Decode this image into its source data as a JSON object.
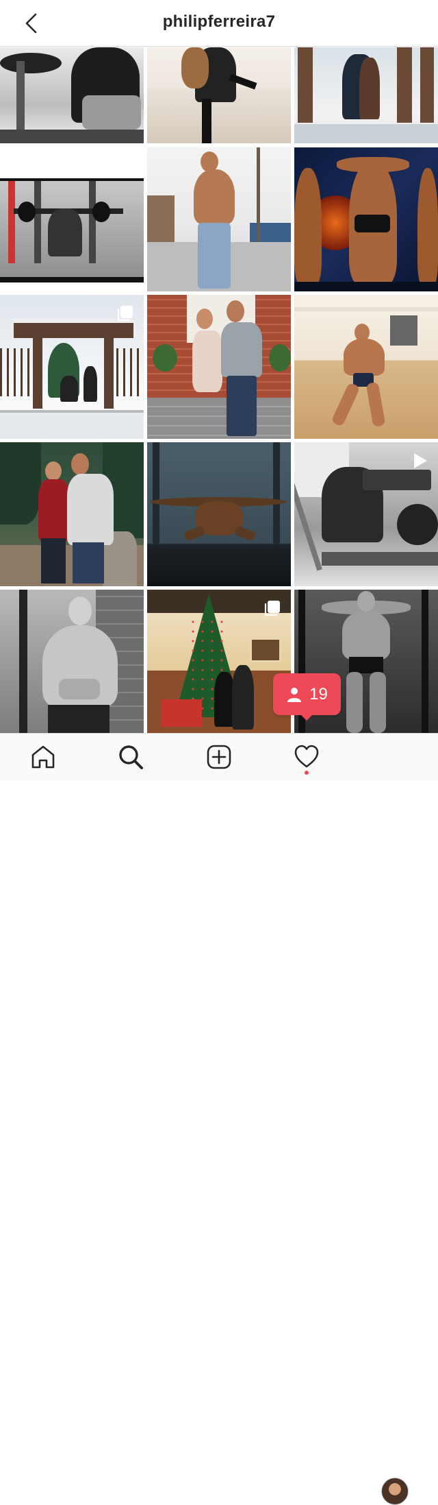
{
  "header": {
    "username": "philipferreira7",
    "back_icon": "chevron-left-icon"
  },
  "grid": {
    "posts": [
      {
        "name": "gym-bench-bw",
        "type": "photo"
      },
      {
        "name": "couple-snow-lift",
        "type": "photo"
      },
      {
        "name": "couple-snow-gate",
        "type": "photo"
      },
      {
        "name": "gym-squat",
        "type": "photo"
      },
      {
        "name": "shirtless-street",
        "type": "photo"
      },
      {
        "name": "bodybuilding-stage-pose",
        "type": "photo"
      },
      {
        "name": "proposal-gazebo-snow",
        "type": "carousel"
      },
      {
        "name": "couple-front-steps",
        "type": "photo"
      },
      {
        "name": "gym-floor-pose",
        "type": "photo"
      },
      {
        "name": "couple-forest",
        "type": "photo"
      },
      {
        "name": "studio-pose-dark",
        "type": "photo"
      },
      {
        "name": "gym-machine-bw",
        "type": "video"
      },
      {
        "name": "portrait-bw-arms-crossed",
        "type": "photo"
      },
      {
        "name": "christmas-tree-couple",
        "type": "carousel"
      },
      {
        "name": "bodybuilder-bw-flex",
        "type": "photo"
      }
    ]
  },
  "notification": {
    "count": "19",
    "icon": "person-icon",
    "color": "#ed4956"
  },
  "tabbar": {
    "tabs": [
      {
        "name": "home",
        "icon": "home-icon"
      },
      {
        "name": "search",
        "icon": "search-icon"
      },
      {
        "name": "new-post",
        "icon": "add-square-icon"
      },
      {
        "name": "activity",
        "icon": "heart-icon"
      },
      {
        "name": "profile",
        "icon": "avatar"
      }
    ]
  }
}
